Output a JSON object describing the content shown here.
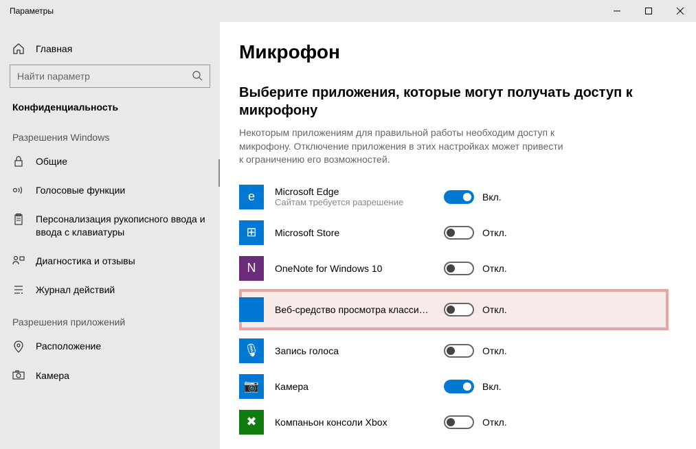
{
  "window": {
    "title": "Параметры"
  },
  "sidebar": {
    "home": "Главная",
    "search_placeholder": "Найти параметр",
    "category": "Конфиденциальность",
    "section1": "Разрешения Windows",
    "items1": [
      {
        "label": "Общие"
      },
      {
        "label": "Голосовые функции"
      },
      {
        "label": "Персонализация рукописного ввода и ввода с клавиатуры"
      },
      {
        "label": "Диагностика и отзывы"
      },
      {
        "label": "Журнал действий"
      }
    ],
    "section2": "Разрешения приложений",
    "items2": [
      {
        "label": "Расположение"
      },
      {
        "label": "Камера"
      }
    ]
  },
  "main": {
    "title": "Микрофон",
    "section_title": "Выберите приложения, которые могут получать доступ к микрофону",
    "section_desc": "Некоторым приложениям для правильной работы необходим доступ к микрофону. Отключение приложения в этих настройках может привести к ограничению его возможностей.",
    "on_label": "Вкл.",
    "off_label": "Откл.",
    "apps": [
      {
        "name": "Microsoft Edge",
        "sub": "Сайтам требуется разрешение",
        "state": "on",
        "color": "#0078d4",
        "glyph": "e"
      },
      {
        "name": "Microsoft Store",
        "sub": "",
        "state": "off",
        "color": "#0078d4",
        "glyph": "⊞"
      },
      {
        "name": "OneNote for Windows 10",
        "sub": "",
        "state": "off",
        "color": "#6b2d7a",
        "glyph": "N"
      },
      {
        "name": "Веб-средство просмотра классиче...",
        "sub": "",
        "state": "off",
        "color": "#0078d4",
        "glyph": "",
        "hl": true
      },
      {
        "name": "Запись голоса",
        "sub": "",
        "state": "off",
        "color": "#0078d4",
        "glyph": "🎙"
      },
      {
        "name": "Камера",
        "sub": "",
        "state": "on",
        "color": "#0078d4",
        "glyph": "📷"
      },
      {
        "name": "Компаньон консоли Xbox",
        "sub": "",
        "state": "off",
        "color": "#107c10",
        "glyph": "✖"
      }
    ]
  }
}
